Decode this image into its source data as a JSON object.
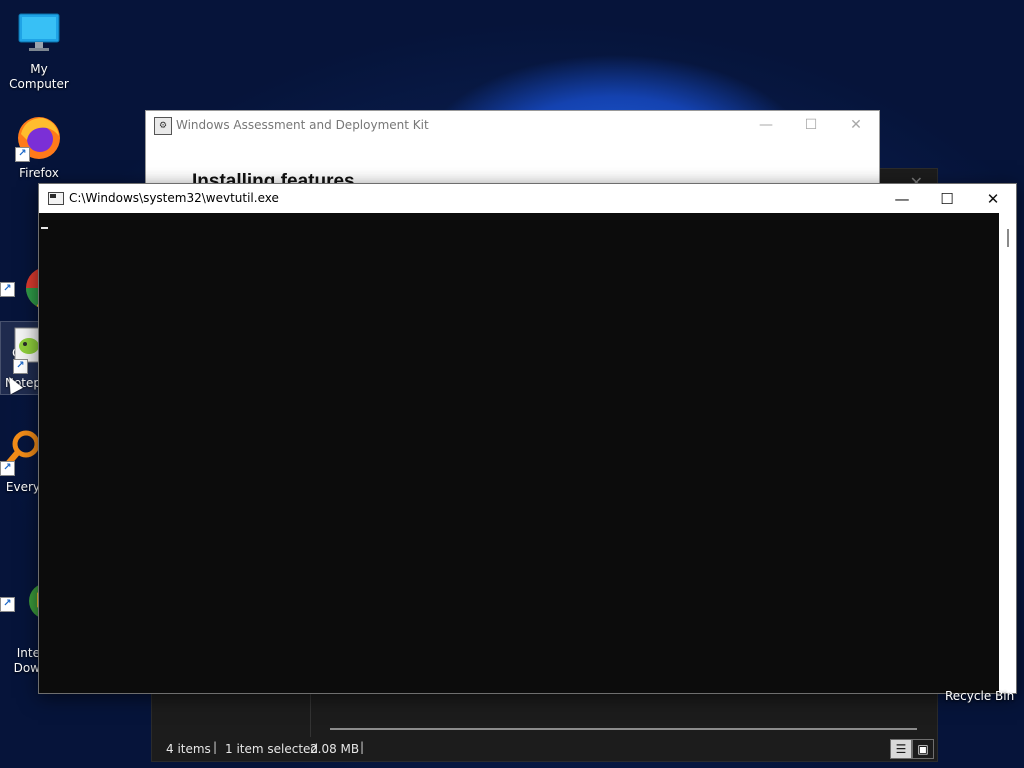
{
  "desktop": {
    "icons": [
      {
        "label": "My Computer",
        "icon": "monitor-icon"
      },
      {
        "label": "Firefox",
        "icon": "firefox-icon"
      },
      {
        "label": "Goo\nChro",
        "icon": "chrome-icon"
      },
      {
        "label": "Notep",
        "icon": "notepad-plus-plus-icon"
      },
      {
        "label": "Every",
        "icon": "everything-search-icon"
      },
      {
        "label": "Inte\nDow",
        "icon": "internet-download-manager-icon"
      }
    ],
    "recycle_bin_label": "Recycle Bin"
  },
  "adk_window": {
    "title": "Windows Assessment and Deployment Kit",
    "heading": "Installing features",
    "minimize_glyph": "—",
    "maximize_glyph": "☐",
    "close_glyph": "✕"
  },
  "console_window": {
    "title": "C:\\Windows\\system32\\wevtutil.exe",
    "minimize_glyph": "—",
    "maximize_glyph": "☐",
    "close_glyph": "✕",
    "output": ""
  },
  "explorer_window": {
    "close_glyph": "✕",
    "status": {
      "item_count": "4 items",
      "selection": "1 item selected",
      "size": "2.08 MB"
    },
    "view_buttons": [
      {
        "name": "details-view",
        "glyph": "☰"
      },
      {
        "name": "large-icons-view",
        "glyph": "▣"
      }
    ]
  },
  "colors": {
    "console_bg": "#0c0c0c",
    "desktop_accent": "#1f5fd8",
    "explorer_bg": "#1c1c1c"
  }
}
